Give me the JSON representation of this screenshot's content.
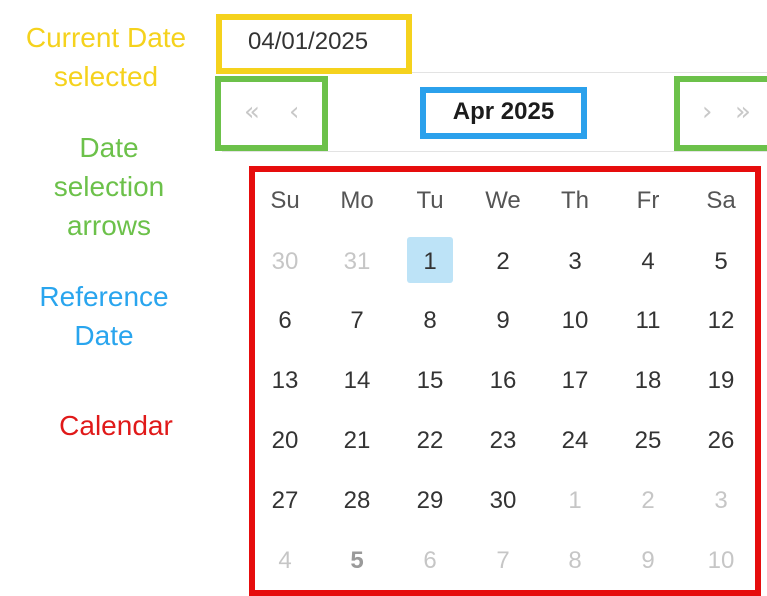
{
  "legend": {
    "current_date_line1": "Current Date",
    "current_date_line2": "selected",
    "arrows_line1": "Date",
    "arrows_line2": "selection",
    "arrows_line3": "arrows",
    "reference_line1": "Reference",
    "reference_line2": "Date",
    "calendar": "Calendar"
  },
  "colors": {
    "current_date": "#f5d21d",
    "arrows": "#6cc14a",
    "reference": "#29a5ee",
    "calendar": "#e01919",
    "selected_day_bg": "#bde3f7"
  },
  "date_input": {
    "value": "04/01/2025"
  },
  "nav": {
    "prev_year": "«",
    "prev_month": "‹",
    "next_month": "›",
    "next_year": "»",
    "reference_label": "Apr 2025"
  },
  "calendar": {
    "weekdays": [
      "Su",
      "Mo",
      "Tu",
      "We",
      "Th",
      "Fr",
      "Sa"
    ],
    "weeks": [
      [
        "30",
        "31",
        "1",
        "2",
        "3",
        "4",
        "5"
      ],
      [
        "6",
        "7",
        "8",
        "9",
        "10",
        "11",
        "12"
      ],
      [
        "13",
        "14",
        "15",
        "16",
        "17",
        "18",
        "19"
      ],
      [
        "20",
        "21",
        "22",
        "23",
        "24",
        "25",
        "26"
      ],
      [
        "27",
        "28",
        "29",
        "30",
        "1",
        "2",
        "3"
      ],
      [
        "4",
        "5",
        "6",
        "7",
        "8",
        "9",
        "10"
      ]
    ],
    "selected_day": "1"
  }
}
